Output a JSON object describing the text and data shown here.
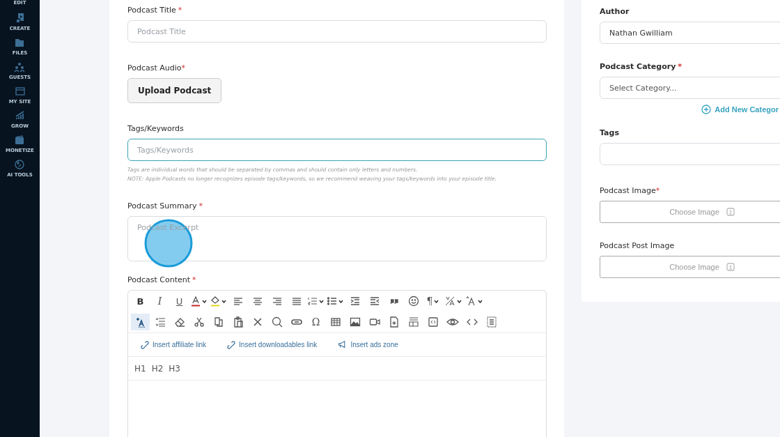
{
  "sidebar": {
    "items": [
      {
        "label": "EDIT"
      },
      {
        "label": "CREATE"
      },
      {
        "label": "FILES"
      },
      {
        "label": "GUESTS"
      },
      {
        "label": "MY SITE"
      },
      {
        "label": "GROW"
      },
      {
        "label": "MONETIZE"
      },
      {
        "label": "AI TOOLS"
      }
    ]
  },
  "form": {
    "title": {
      "label": "Podcast Title",
      "required_mark": "*",
      "placeholder": "Podcast Title"
    },
    "audio": {
      "label": "Podcast Audio",
      "required_mark": "*",
      "button": "Upload Podcast"
    },
    "tags": {
      "label": "Tags/Keywords",
      "placeholder": "Tags/Keywords",
      "focused": true,
      "hints": [
        "Tags are individual words that should be separated by commas and should contain only letters and numbers.",
        "NOTE: Apple Podcasts no longer recognizes episode tags/keywords, so we recommend weaving your tags/keywords into your episode title."
      ]
    },
    "summary": {
      "label": "Podcast Summary",
      "required_mark": "*",
      "placeholder": "Podcast Excerpt"
    },
    "content": {
      "label": "Podcast Content",
      "required_mark": "*",
      "toolbar_rows": [
        [
          {
            "kind": "bold",
            "glyph": "B",
            "selected": false
          },
          {
            "kind": "italic",
            "glyph": "I",
            "selected": false
          },
          {
            "kind": "underline",
            "glyph": "U",
            "selected": false
          },
          {
            "kind": "font-color",
            "dropdown": true,
            "selected": false
          },
          {
            "kind": "highlight",
            "dropdown": true,
            "selected": false
          },
          {
            "kind": "align-left",
            "selected": false
          },
          {
            "kind": "align-center",
            "selected": false
          },
          {
            "kind": "align-right",
            "selected": false
          },
          {
            "kind": "justify",
            "selected": false
          },
          {
            "kind": "ordered-list",
            "dropdown": true,
            "selected": false
          },
          {
            "kind": "bullet-list",
            "dropdown": true,
            "selected": false
          },
          {
            "kind": "indent",
            "selected": false
          },
          {
            "kind": "outdent",
            "selected": false
          },
          {
            "kind": "quote",
            "selected": false
          },
          {
            "kind": "emoji",
            "selected": false
          },
          {
            "kind": "paragraph",
            "glyph": "¶",
            "dropdown": true,
            "selected": false
          },
          {
            "kind": "text-size",
            "dropdown": true,
            "selected": false
          },
          {
            "kind": "font-size",
            "dropdown": true,
            "selected": false
          }
        ],
        [
          {
            "kind": "add-format",
            "selected": true
          },
          {
            "kind": "line-height",
            "selected": false
          },
          {
            "kind": "eraser",
            "selected": false
          },
          {
            "kind": "cut",
            "selected": false
          },
          {
            "kind": "copy",
            "selected": false
          },
          {
            "kind": "paste",
            "selected": false
          },
          {
            "kind": "close",
            "selected": false
          },
          {
            "kind": "search",
            "selected": false
          },
          {
            "kind": "link",
            "selected": false
          },
          {
            "kind": "special-char",
            "glyph": "Ω",
            "selected": false
          },
          {
            "kind": "table",
            "selected": false
          },
          {
            "kind": "image",
            "selected": false
          },
          {
            "kind": "video",
            "selected": false
          },
          {
            "kind": "file",
            "selected": false
          },
          {
            "kind": "template",
            "selected": false
          },
          {
            "kind": "embed",
            "selected": false
          },
          {
            "kind": "preview",
            "selected": false
          },
          {
            "kind": "code",
            "selected": false
          },
          {
            "kind": "select-all",
            "selected": false
          }
        ]
      ],
      "inserts": [
        {
          "label": "Insert affiliate link",
          "kind": "link"
        },
        {
          "label": "Insert downloadables link",
          "kind": "link"
        },
        {
          "label": "Insert ads zone",
          "kind": "ads"
        }
      ],
      "headings": [
        "H1",
        "H2",
        "H3"
      ]
    }
  },
  "aside": {
    "author": {
      "label": "Author",
      "value": "Nathan Gwilliam"
    },
    "category": {
      "label": "Podcast Category",
      "required_mark": "*",
      "placeholder": "Select Category...",
      "add_link": "Add New Categor"
    },
    "tags": {
      "label": "Tags"
    },
    "image": {
      "label": "Podcast Image",
      "required_mark": "*",
      "button": "Choose Image"
    },
    "post_image": {
      "label": "Podcast Post Image",
      "button": "Choose Image"
    }
  }
}
